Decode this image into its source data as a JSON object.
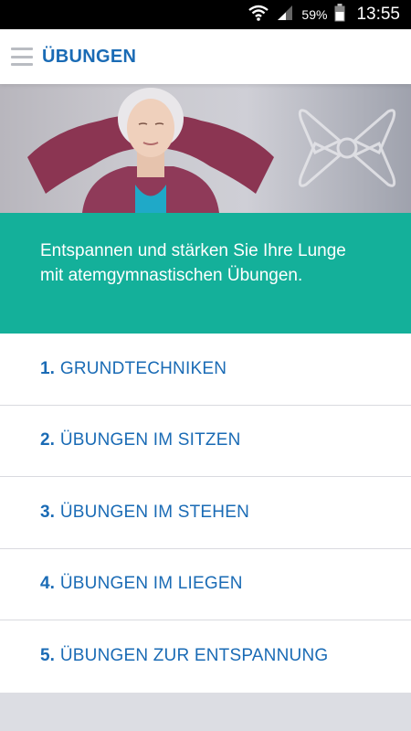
{
  "status_bar": {
    "battery_percent": "59%",
    "time": "13:55",
    "icons": [
      "wifi-icon",
      "signal-icon",
      "battery-icon"
    ]
  },
  "app_bar": {
    "menu_icon": "hamburger-menu-icon",
    "title": "ÜBUNGEN"
  },
  "hero": {
    "image": "woman-breathing-photo",
    "logo_icon": "pinwheel-logo-icon"
  },
  "intro": {
    "text": "Entspannen und stärken Sie Ihre Lunge mit atemgymnastischen Übungen."
  },
  "menu": {
    "items": [
      {
        "num": "1.",
        "label": "GRUNDTECHNIKEN"
      },
      {
        "num": "2.",
        "label": "ÜBUNGEN IM SITZEN"
      },
      {
        "num": "3.",
        "label": "ÜBUNGEN IM STEHEN"
      },
      {
        "num": "4.",
        "label": "ÜBUNGEN IM LIEGEN"
      },
      {
        "num": "5.",
        "label": "ÜBUNGEN ZUR ENTSPANNUNG"
      }
    ]
  },
  "colors": {
    "brand_blue": "#1a6bb5",
    "teal": "#14b09a",
    "background_gray": "#dcdde3"
  }
}
